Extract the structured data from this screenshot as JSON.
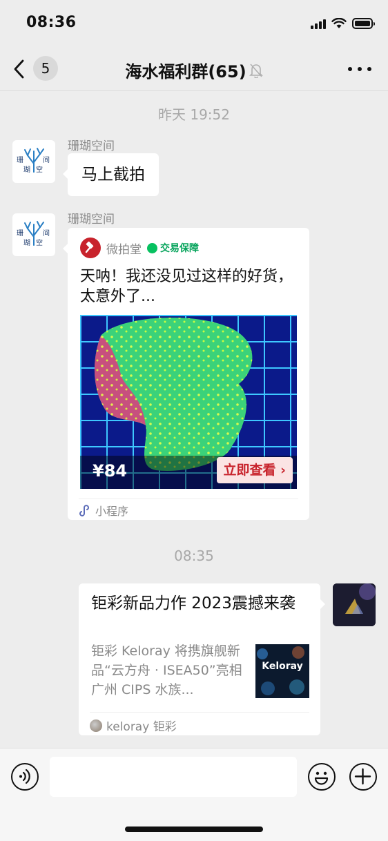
{
  "status_bar": {
    "time": "08:36"
  },
  "nav": {
    "unread_count": "5",
    "title": "海水福利群(65)",
    "back_icon": "chevron-left-icon",
    "mute_icon": "bell-off-icon",
    "more_icon": "more-horizontal-icon"
  },
  "timestamps": [
    "昨天 19:52",
    "08:35"
  ],
  "messages": [
    {
      "sender": "珊瑚空间",
      "type": "text",
      "text": "马上截拍"
    },
    {
      "sender": "珊瑚空间",
      "type": "mini_program",
      "app_name": "微拍堂",
      "guarantee": "交易保障",
      "title": "天呐！我还没见过这样的好货，太意外了...",
      "price": "¥84",
      "cta": "立即查看",
      "footer": "小程序"
    },
    {
      "type": "link",
      "title": "钜彩新品力作 2023震撼来袭",
      "description": "钜彩 Keloray 将携旗舰新品“云方舟 · ISEA50”亮相广州 CIPS 水族...",
      "thumbnail_text": "Keloray",
      "source": "keloray 钜彩"
    }
  ],
  "input": {
    "placeholder": ""
  },
  "colors": {
    "background": "#ededed",
    "bubble": "#ffffff",
    "brand_red": "#c8232c",
    "guarantee_green": "#07c160",
    "muted_text": "#8a8a8a"
  }
}
